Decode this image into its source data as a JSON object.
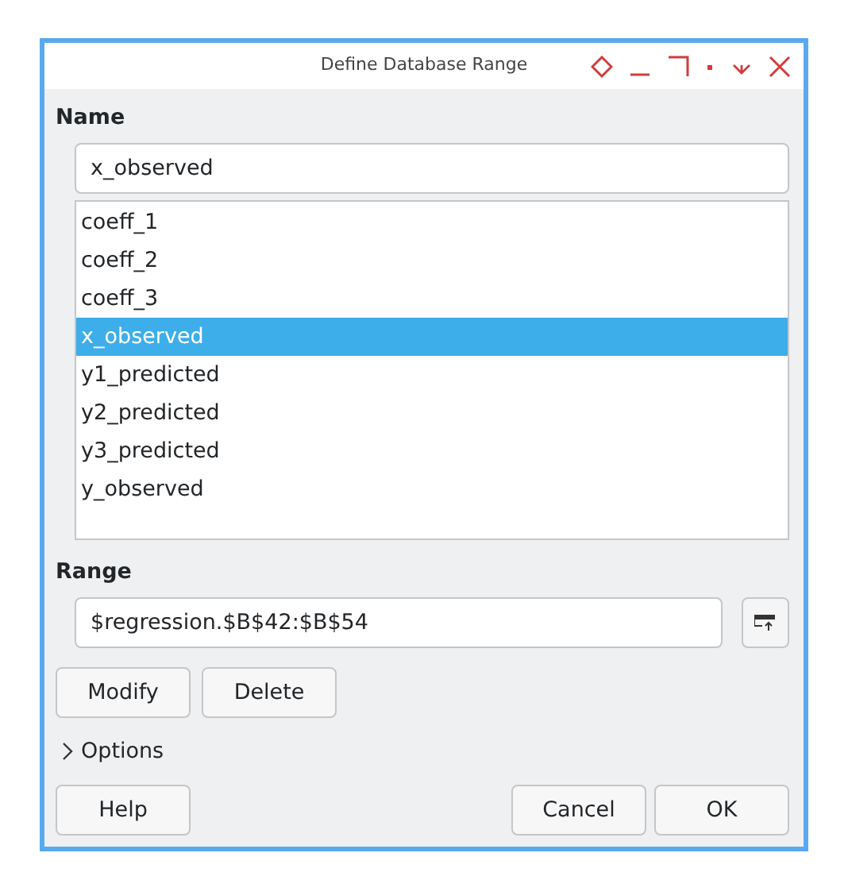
{
  "window": {
    "title": "Define Database Range"
  },
  "name": {
    "label": "Name",
    "value": "x_observed"
  },
  "names": [
    {
      "label": "coeff_1",
      "selected": false
    },
    {
      "label": "coeff_2",
      "selected": false
    },
    {
      "label": "coeff_3",
      "selected": false
    },
    {
      "label": "x_observed",
      "selected": true
    },
    {
      "label": "y1_predicted",
      "selected": false
    },
    {
      "label": "y2_predicted",
      "selected": false
    },
    {
      "label": "y3_predicted",
      "selected": false
    },
    {
      "label": "y_observed",
      "selected": false
    }
  ],
  "range": {
    "label": "Range",
    "value": "$regression.$B$42:$B$54"
  },
  "actions": [
    "Modify",
    "Delete"
  ],
  "options": {
    "label": "Options",
    "expanded": false
  },
  "footer": {
    "help": "Help",
    "buttons": [
      "Cancel",
      "OK"
    ]
  }
}
